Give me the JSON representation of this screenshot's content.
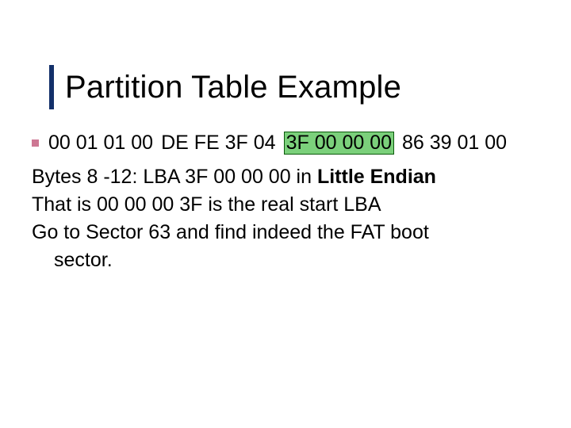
{
  "title": "Partition Table Example",
  "hex_bytes": {
    "group1": "00 01 01 00",
    "group2": "DE FE 3F 04",
    "highlight": "3F 00 00 00",
    "group4": "86 39 01 00"
  },
  "explain": {
    "line1_pre": "Bytes 8 -12: LBA 3F 00 00 00 in ",
    "line1_bold": "Little Endian",
    "line2": "That is 00 00 00 3F is the real start LBA",
    "line3": "Go to Sector 63 and find indeed the FAT boot",
    "line4_indent": "sector."
  }
}
